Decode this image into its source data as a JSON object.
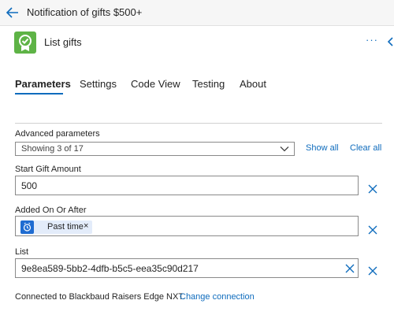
{
  "header": {
    "title": "Notification of gifts $500+",
    "back_icon": "arrow-left-icon"
  },
  "action": {
    "title": "List gifts",
    "icon": "gift-check-icon",
    "icon_color": "#5eb346",
    "more_label": "···",
    "collapse_icon": "chevron-left-icon"
  },
  "tabs": [
    {
      "label": "Parameters",
      "active": true
    },
    {
      "label": "Settings",
      "active": false
    },
    {
      "label": "Code View",
      "active": false
    },
    {
      "label": "Testing",
      "active": false
    },
    {
      "label": "About",
      "active": false
    }
  ],
  "advanced": {
    "label": "Advanced parameters",
    "selected": "Showing 3 of 17",
    "show_all": "Show all",
    "clear_all": "Clear all"
  },
  "fields": {
    "start_amount": {
      "label": "Start Gift Amount",
      "value": "500"
    },
    "added_on": {
      "label": "Added On Or After",
      "token_label": "Past time",
      "token_remove": "×",
      "token_icon": "clock-icon"
    },
    "list": {
      "label": "List",
      "value": "9e8ea589-5bb2-4dfb-b5c5-eea35c90d217"
    }
  },
  "footer": {
    "text": "Connected to Blackbaud Raisers Edge NXT.",
    "link": "Change connection"
  },
  "colors": {
    "accent": "#0f6cbd",
    "token_bg": "#e3ecfa",
    "token_icon_bg": "#1f6cd1"
  }
}
